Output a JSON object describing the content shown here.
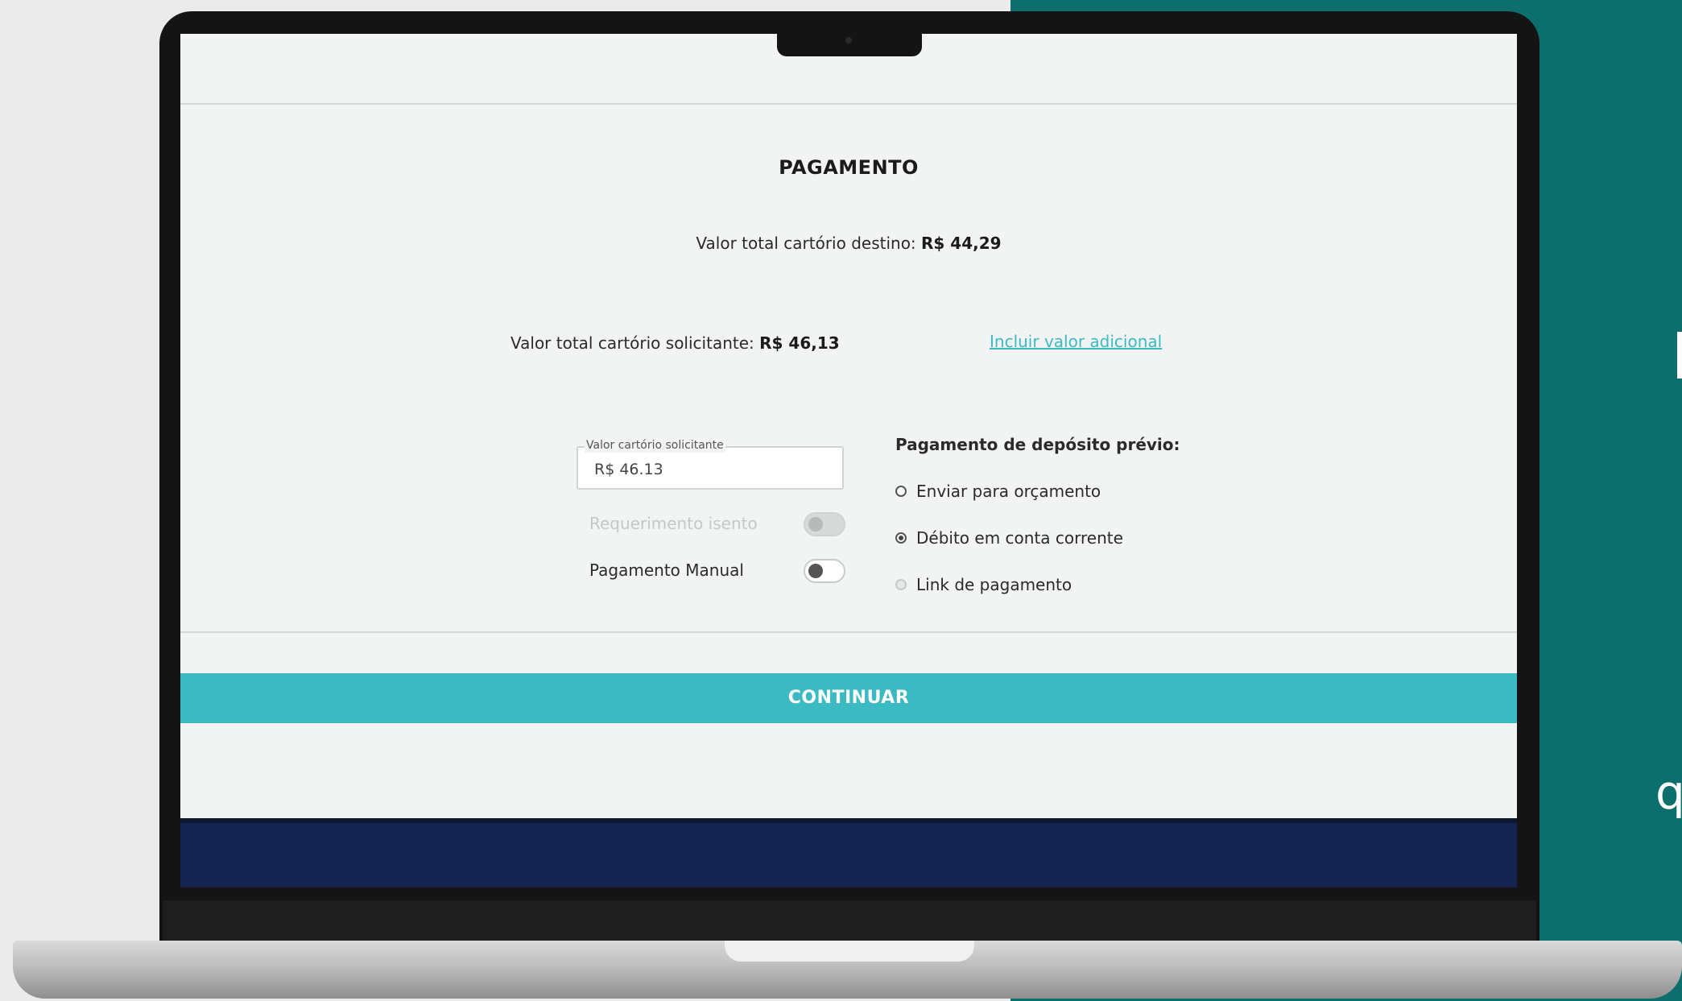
{
  "colors": {
    "accent": "#3bbac4",
    "background_teal": "#0c6e6d",
    "footer_navy": "#142350"
  },
  "payment": {
    "title": "PAGAMENTO",
    "destino_label": "Valor total cartório destino:",
    "destino_value": "R$ 44,29",
    "solicitante_label": "Valor total cartório solicitante:",
    "solicitante_value": "R$ 46,13",
    "add_value_link": "Incluir valor adicional",
    "field": {
      "label": "Valor cartório solicitante",
      "value": "R$ 46.13"
    },
    "toggles": [
      {
        "label": "Requerimento isento",
        "on": false,
        "disabled": true
      },
      {
        "label": "Pagamento Manual",
        "on": false,
        "disabled": false
      }
    ],
    "deposit_title": "Pagamento de depósito prévio:",
    "options": [
      {
        "label": "Enviar para orçamento",
        "selected": false
      },
      {
        "label": "Débito em conta corrente",
        "selected": true
      },
      {
        "label": "Link de pagamento",
        "selected": false
      }
    ],
    "continue_button": "CONTINUAR"
  },
  "edge_text": "q"
}
